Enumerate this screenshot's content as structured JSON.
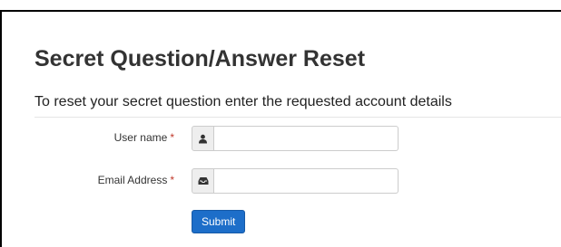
{
  "page": {
    "title": "Secret Question/Answer Reset",
    "instructions": "To reset your secret question enter the requested account details"
  },
  "form": {
    "required_marker": "*",
    "username": {
      "label": "User name",
      "value": "",
      "icon": "user-icon"
    },
    "email": {
      "label": "Email Address",
      "value": "",
      "icon": "inbox-icon"
    },
    "submit_label": "Submit"
  },
  "colors": {
    "submit_button": "#1d6ec9",
    "required_marker": "#c0392b",
    "addon_background": "#eeeeee"
  }
}
